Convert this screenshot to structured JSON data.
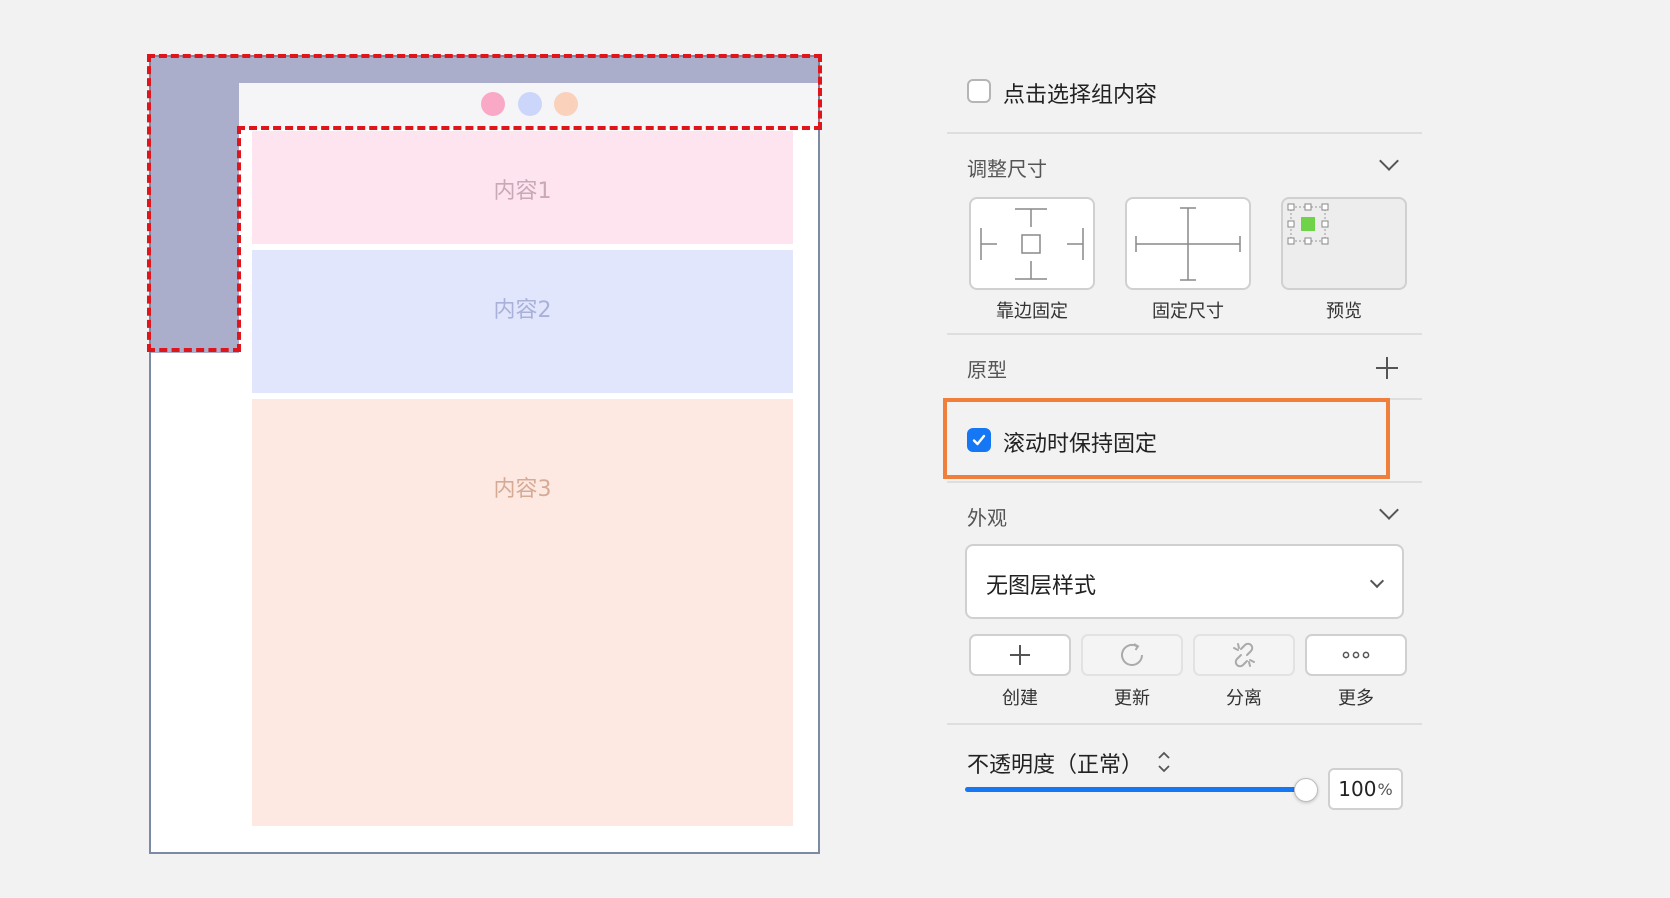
{
  "canvas": {
    "contents": [
      {
        "label": "内容1"
      },
      {
        "label": "内容2"
      },
      {
        "label": "内容3"
      }
    ],
    "window_dots": [
      "pink",
      "blue",
      "peach"
    ]
  },
  "inspector": {
    "click_select_group": {
      "label": "点击选择组内容",
      "checked": false
    },
    "resize": {
      "title": "调整尺寸",
      "options": [
        {
          "label": "靠边固定",
          "icon": "pin-edges-icon"
        },
        {
          "label": "固定尺寸",
          "icon": "fixed-size-icon"
        },
        {
          "label": "预览",
          "icon": "preview-icon"
        }
      ]
    },
    "prototype": {
      "title": "原型",
      "fix_on_scroll": {
        "label": "滚动时保持固定",
        "checked": true
      }
    },
    "appearance": {
      "title": "外观",
      "layer_style": "无图层样式",
      "actions": [
        {
          "label": "创建",
          "icon": "plus-icon",
          "enabled": true
        },
        {
          "label": "更新",
          "icon": "refresh-icon",
          "enabled": false
        },
        {
          "label": "分离",
          "icon": "detach-link-icon",
          "enabled": false
        },
        {
          "label": "更多",
          "icon": "more-dots-icon",
          "enabled": true
        }
      ]
    },
    "opacity": {
      "label": "不透明度（正常）",
      "value": "100",
      "unit": "%",
      "fraction": 1.0
    }
  },
  "colors": {
    "accent": "#1677f5",
    "highlight": "#f07f3c",
    "selection_dash": "#e0141b"
  }
}
